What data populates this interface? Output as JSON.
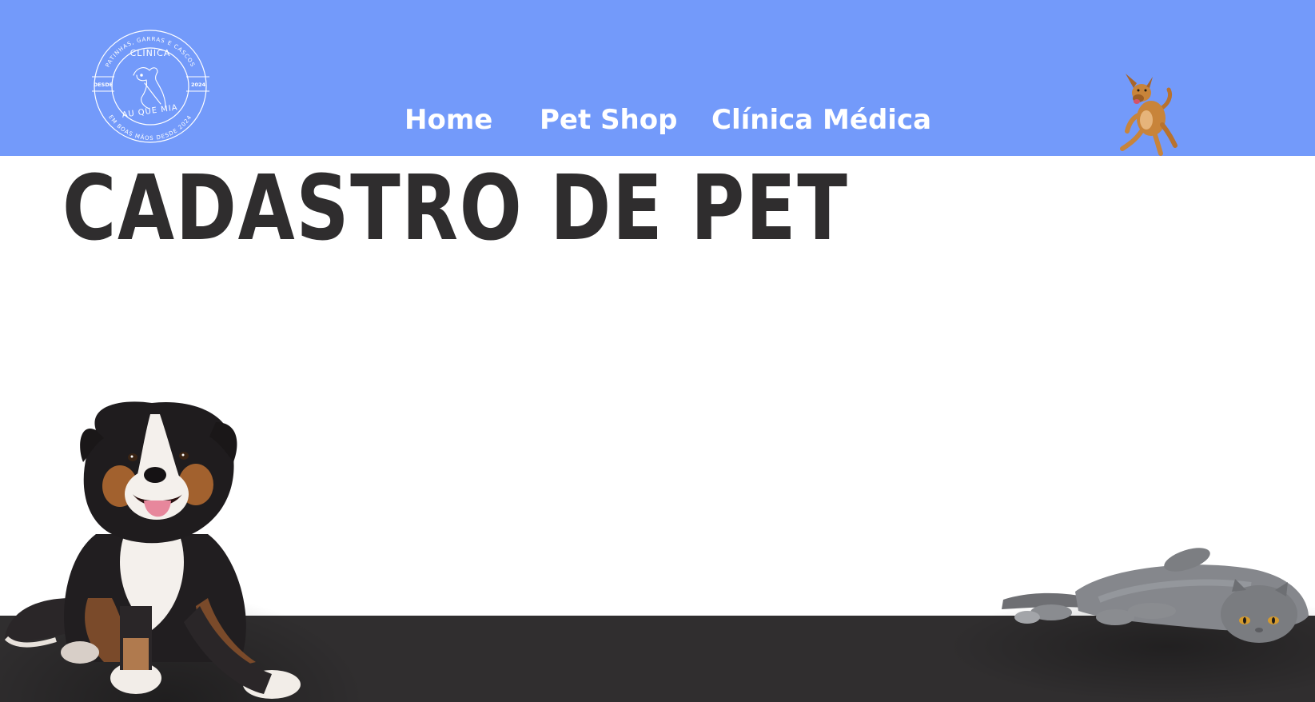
{
  "header": {
    "background_color": "#739afa",
    "logo": {
      "icon": "clinic-logo-icon",
      "arc_top": "PATINHAS, GARRAS E CASCOS",
      "name": "CLÍNICA",
      "left_tag": "DESDE",
      "right_tag": "2024",
      "brand": "AU QUE MIA",
      "arc_bottom": "EM BOAS MÃOS DESDE 2024"
    },
    "nav": {
      "items": [
        {
          "label": "Home"
        },
        {
          "label": "Pet Shop"
        },
        {
          "label": "Clínica Médica"
        }
      ]
    },
    "mascot_icon": "running-dog-icon"
  },
  "main": {
    "title": "CADASTRO DE PET"
  },
  "footer": {
    "background_color": "#302e2f",
    "left_image_icon": "sitting-dog-illustration",
    "right_image_icon": "lying-cat-illustration"
  },
  "colors": {
    "title": "#2f2d2e",
    "nav_text": "#ffffff"
  }
}
